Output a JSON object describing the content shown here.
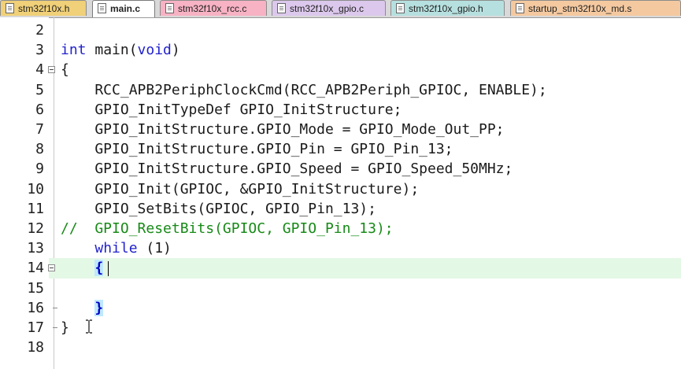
{
  "tabs": [
    {
      "label": "stm32f10x.h",
      "active": false,
      "color": "#f0d078"
    },
    {
      "label": "main.c",
      "active": true,
      "color": "#ffffff"
    },
    {
      "label": "stm32f10x_rcc.c",
      "active": false,
      "color": "#f7b2c4"
    },
    {
      "label": "stm32f10x_gpio.c",
      "active": false,
      "color": "#dcc8ec"
    },
    {
      "label": "stm32f10x_gpio.h",
      "active": false,
      "color": "#b6e0df"
    },
    {
      "label": "startup_stm32f10x_md.s",
      "active": false,
      "color": "#f5c9a0"
    }
  ],
  "editor": {
    "current_line": 14,
    "current_line_color": "#e4f8e6",
    "lines": [
      {
        "num": "2",
        "text": ""
      },
      {
        "num": "3",
        "text": "int main(void)"
      },
      {
        "num": "4",
        "text": "{"
      },
      {
        "num": "5",
        "text": "    RCC_APB2PeriphClockCmd(RCC_APB2Periph_GPIOC, ENABLE);"
      },
      {
        "num": "6",
        "text": "    GPIO_InitTypeDef GPIO_InitStructure;"
      },
      {
        "num": "7",
        "text": "    GPIO_InitStructure.GPIO_Mode = GPIO_Mode_Out_PP;"
      },
      {
        "num": "8",
        "text": "    GPIO_InitStructure.GPIO_Pin = GPIO_Pin_13;"
      },
      {
        "num": "9",
        "text": "    GPIO_InitStructure.GPIO_Speed = GPIO_Speed_50MHz;"
      },
      {
        "num": "10",
        "text": "    GPIO_Init(GPIOC, &GPIO_InitStructure);"
      },
      {
        "num": "11",
        "text": "    GPIO_SetBits(GPIOC, GPIO_Pin_13);"
      },
      {
        "num": "12",
        "text": "//  GPIO_ResetBits(GPIOC, GPIO_Pin_13);"
      },
      {
        "num": "13",
        "text": "    while (1)"
      },
      {
        "num": "14",
        "text": "    {"
      },
      {
        "num": "15",
        "text": ""
      },
      {
        "num": "16",
        "text": "    }"
      },
      {
        "num": "17",
        "text": "}"
      },
      {
        "num": "18",
        "text": ""
      }
    ],
    "syntax_colors": {
      "keyword": "#2222cc",
      "comment": "#178a17",
      "text": "#1a1a1a"
    }
  }
}
